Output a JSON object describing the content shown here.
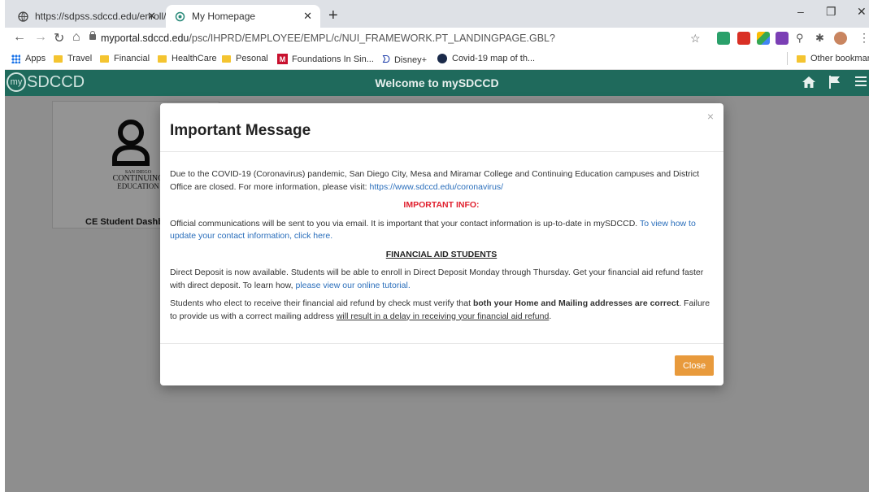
{
  "browser": {
    "tabs": [
      {
        "title": "https://sdpss.sdccd.edu/enroll/"
      },
      {
        "title": "My Homepage"
      }
    ],
    "url_host": "myportal.sdccd.edu",
    "url_path": "/psc/IHPRD/EMPLOYEE/EMPL/c/NUI_FRAMEWORK.PT_LANDINGPAGE.GBL?",
    "bookmarks": [
      "Apps",
      "Travel",
      "Financial",
      "HealthCare",
      "Pesonal",
      "Foundations In Sin...",
      "Disney+",
      "Covid-19 map of th..."
    ],
    "other_bookmarks": "Other bookmarks"
  },
  "header": {
    "logo_text": "SDCCD",
    "logo_prefix": "my",
    "welcome": "Welcome to mySDCCD"
  },
  "tile": {
    "logo_line1": "SAN DIEGO",
    "logo_line2": "CONTINUING",
    "logo_line3": "EDUCATION",
    "label": "CE Student Dashb"
  },
  "modal": {
    "title": "Important Message",
    "p1": "Due to the COVID-19 (Coronavirus) pandemic, San Diego City, Mesa and Miramar College and Continuing Education campuses and District Office are closed. For more information, please visit: ",
    "p1_link": "https://www.sdccd.edu/coronavirus/",
    "important_heading": "IMPORTANT INFO:",
    "p2": "Official communications will be sent to you via email.  It is important that your contact information is up-to-date in mySDCCD. ",
    "p2_link": "To view how to update your contact information, click here.",
    "financial_heading": "FINANCIAL AID STUDENTS",
    "p3": "Direct Deposit is now available.  Students will be able to enroll in Direct Deposit Monday through Thursday.  Get your financial aid refund faster with direct deposit.  To learn how, ",
    "p3_link": "please view our online tutorial.",
    "p4_a": "Students who elect to receive their financial aid refund by check must verify that ",
    "p4_bold": "both your Home and Mailing addresses are correct",
    "p4_b": ". Failure to provide us with a correct mailing address ",
    "p4_ul": "will result in a delay in receiving your financial aid refund",
    "p4_c": ".",
    "close_label": "Close"
  },
  "colors": {
    "header_bg": "#1f6a5c",
    "close_button": "#e89a3c",
    "important_red": "#e0202e",
    "link_blue": "#2a6ebb"
  }
}
